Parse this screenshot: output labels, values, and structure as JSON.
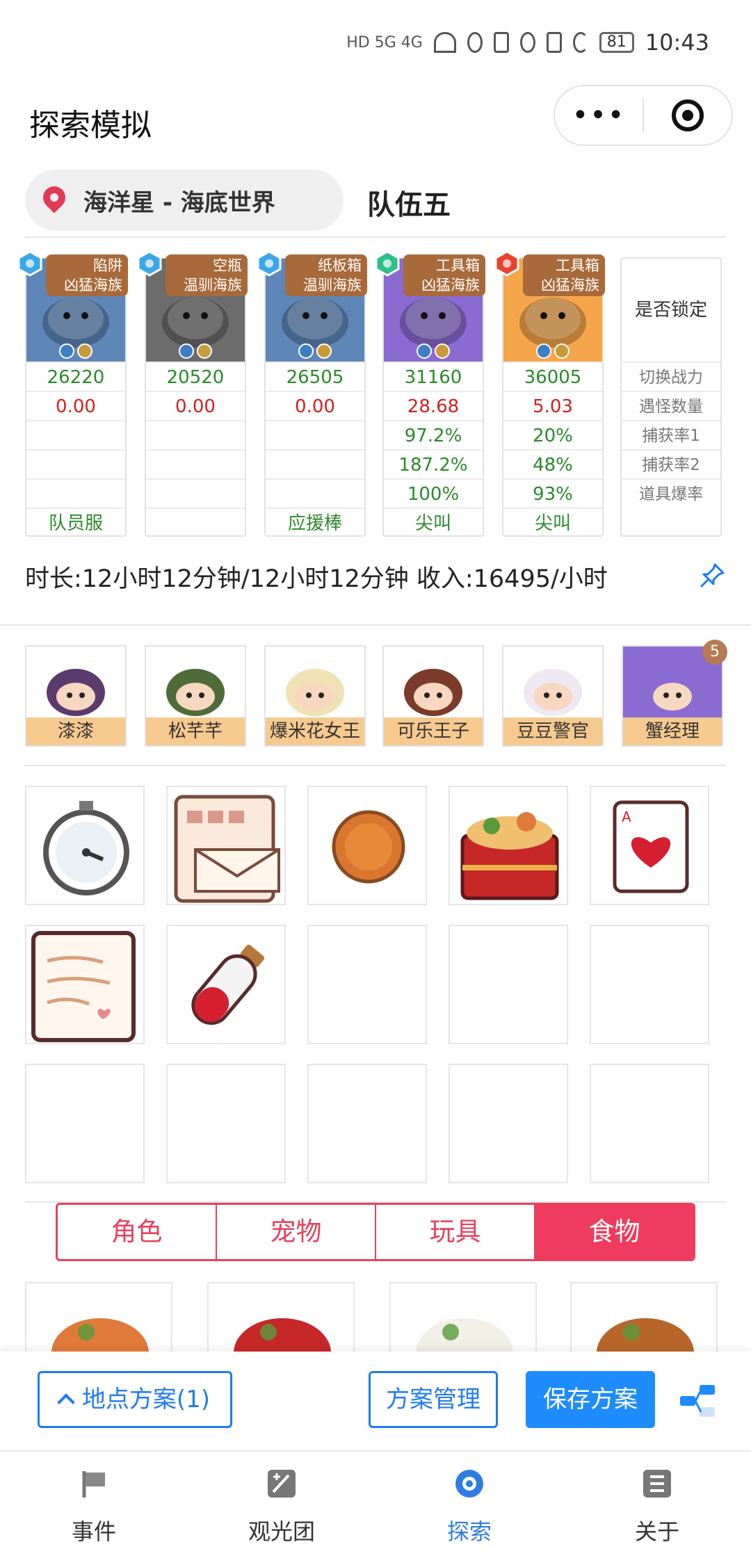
{
  "statusbar": {
    "network": "HD 5G 4G",
    "battery": "81",
    "time": "10:43"
  },
  "header": {
    "title": "探索模拟"
  },
  "location": {
    "text": "海洋星 - 海底世界",
    "team": "队伍五"
  },
  "team": [
    {
      "badge_line1": "陷阱",
      "badge_line2": "凶猛海族",
      "power": "26220",
      "monsters": "0.00",
      "catch1": "",
      "catch2": "",
      "drop": "",
      "equip": "队员服",
      "bg": "#5f86b8",
      "gem": "#3aa7e8"
    },
    {
      "badge_line1": "空瓶",
      "badge_line2": "温驯海族",
      "power": "20520",
      "monsters": "0.00",
      "catch1": "",
      "catch2": "",
      "drop": "",
      "equip": "",
      "bg": "#6c6c6c",
      "gem": "#3aa7e8"
    },
    {
      "badge_line1": "纸板箱",
      "badge_line2": "温驯海族",
      "power": "26505",
      "monsters": "0.00",
      "catch1": "",
      "catch2": "",
      "drop": "",
      "equip": "应援棒",
      "bg": "#5f86b8",
      "gem": "#3aa7e8"
    },
    {
      "badge_line1": "工具箱",
      "badge_line2": "凶猛海族",
      "power": "31160",
      "monsters": "28.68",
      "catch1": "97.2%",
      "catch2": "187.2%",
      "drop": "100%",
      "equip": "尖叫",
      "bg": "#8a6bd1",
      "gem": "#2fbf8a"
    },
    {
      "badge_line1": "工具箱",
      "badge_line2": "凶猛海族",
      "power": "36005",
      "monsters": "5.03",
      "catch1": "20%",
      "catch2": "48%",
      "drop": "93%",
      "equip": "尖叫",
      "bg": "#f6a64a",
      "gem": "#e8432f"
    }
  ],
  "labels": {
    "lock": "是否锁定",
    "power": "切换战力",
    "monsters": "遇怪数量",
    "catch1": "捕获率1",
    "catch2": "捕获率2",
    "drop": "道具爆率"
  },
  "summary": {
    "text": "时长:12小时12分钟/12小时12分钟 收入:16495/小时"
  },
  "tourists": [
    {
      "name": "漆漆"
    },
    {
      "name": "松芊芊"
    },
    {
      "name": "爆米花女王"
    },
    {
      "name": "可乐王子"
    },
    {
      "name": "豆豆警官"
    },
    {
      "name": "蟹经理",
      "count": "5"
    }
  ],
  "items": [
    {
      "icon": "stopwatch-icon"
    },
    {
      "icon": "envelope-icon"
    },
    {
      "icon": "coin-icon"
    },
    {
      "icon": "bento-box-icon"
    },
    {
      "icon": "heart-card-icon"
    },
    {
      "icon": "letter-icon"
    },
    {
      "icon": "potion-icon"
    },
    {
      "icon": ""
    },
    {
      "icon": ""
    },
    {
      "icon": ""
    },
    {
      "icon": ""
    },
    {
      "icon": ""
    },
    {
      "icon": ""
    },
    {
      "icon": ""
    },
    {
      "icon": ""
    }
  ],
  "category_tabs": [
    {
      "label": "角色"
    },
    {
      "label": "宠物"
    },
    {
      "label": "玩具"
    },
    {
      "label": "食物",
      "active": true
    }
  ],
  "actions": {
    "location_plan": "地点方案(1)",
    "plan_manage": "方案管理",
    "save_plan": "保存方案"
  },
  "tabbar": [
    {
      "label": "事件",
      "icon": "flag-icon"
    },
    {
      "label": "观光团",
      "icon": "edit-square-icon"
    },
    {
      "label": "探索",
      "icon": "explore-icon",
      "active": true
    },
    {
      "label": "关于",
      "icon": "list-icon"
    }
  ],
  "colors": {
    "accent_red": "#ef3b5d",
    "accent_blue": "#1e8bff",
    "green_value": "#2a8a2a",
    "red_value": "#d42020"
  }
}
